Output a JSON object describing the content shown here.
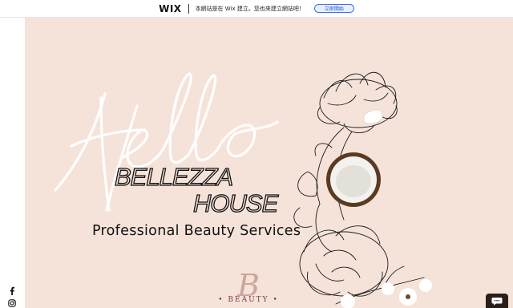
{
  "wix_banner": {
    "logo": "WIX",
    "message": "本網站是在 Wix 建立。您也來建立網站吧！",
    "cta_label": "立即開始"
  },
  "social": {
    "facebook_icon": "facebook-icon",
    "instagram_icon": "instagram-icon"
  },
  "hero": {
    "script_word": "Hello",
    "brand_line_1": "BELLEZZA",
    "brand_line_2": "HOUSE",
    "tagline": "Professional Beauty Services",
    "logo_monogram": "B",
    "logo_word": "• BEAUTY •"
  },
  "chat": {
    "icon": "chat-icon"
  },
  "colors": {
    "hero_background": "#f5e3da",
    "wix_cta_border": "#3b6fe0",
    "logo_accent": "#7a3a42",
    "chat_button": "#2a1f18"
  }
}
